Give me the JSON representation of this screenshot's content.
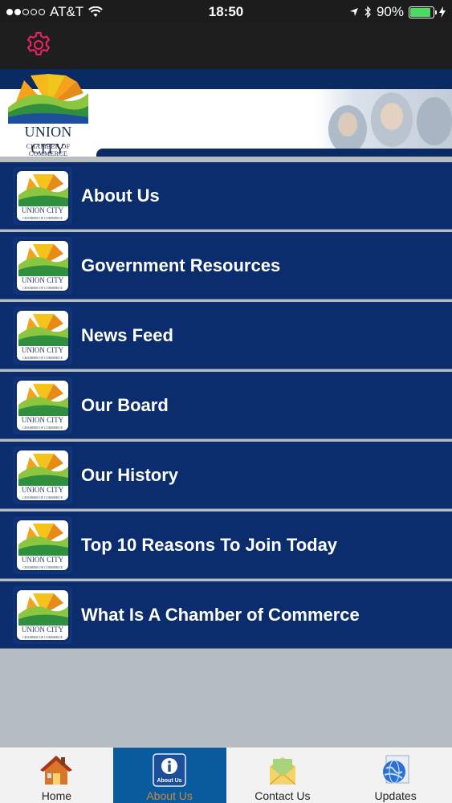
{
  "status_bar": {
    "carrier": "AT&T",
    "time": "18:50",
    "battery_percent": "90%",
    "battery_level": 0.9,
    "signal_bars_filled": 2,
    "signal_bars_total": 5
  },
  "top_nav": {
    "settings_icon": "gear-icon"
  },
  "banner": {
    "logo_title": "UNION CITY",
    "logo_subtitle": "CHAMBER OF COMMERCE"
  },
  "menu_icon_logo": {
    "title": "UNION CITY",
    "subtitle": "CHAMBER OF COMMERCE"
  },
  "menu": {
    "items": [
      {
        "label": "About Us"
      },
      {
        "label": "Government Resources"
      },
      {
        "label": "News Feed"
      },
      {
        "label": "Our Board"
      },
      {
        "label": "Our History"
      },
      {
        "label": "Top 10 Reasons To Join Today"
      },
      {
        "label": "What Is A Chamber of Commerce"
      }
    ]
  },
  "tab_bar": {
    "tabs": [
      {
        "label": "Home",
        "icon": "house-icon",
        "active": false
      },
      {
        "label": "About Us",
        "icon": "info-icon",
        "active": true,
        "icon_text": "About Us"
      },
      {
        "label": "Contact Us",
        "icon": "envelope-icon",
        "active": false
      },
      {
        "label": "Updates",
        "icon": "globe-icon",
        "active": false
      }
    ]
  },
  "colors": {
    "menu_bg": "#0b2d6e",
    "active_tab_bg": "#0a5a9e",
    "active_tab_text": "#c98a3e",
    "settings_icon": "#e0245e"
  }
}
